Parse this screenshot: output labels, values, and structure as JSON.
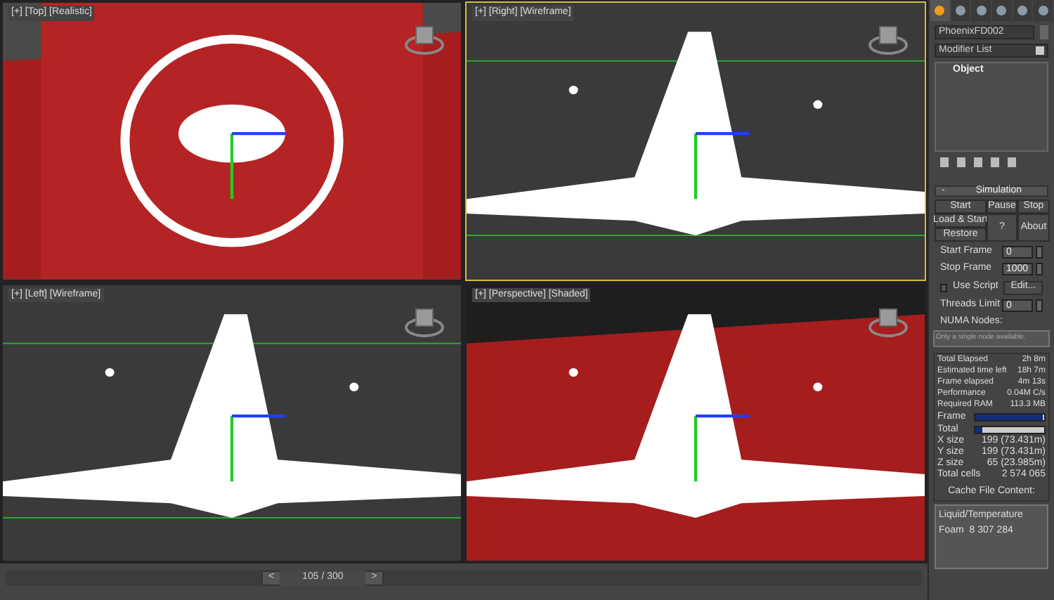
{
  "viewports": [
    {
      "label": "[+] [Top] [Realistic]",
      "kind": "realistic",
      "active": false
    },
    {
      "label": "[+] [Right] [Wireframe]",
      "kind": "wireframe",
      "active": true
    },
    {
      "label": "[+] [Left] [Wireframe]",
      "kind": "wireframe",
      "active": false
    },
    {
      "label": "[+] [Perspective] [Shaded]",
      "kind": "shaded",
      "active": false
    }
  ],
  "time_slider": {
    "prev": "<",
    "thumb": "105 / 300",
    "next": ">"
  },
  "command_panel": {
    "tabs": [
      {
        "selected": true
      },
      {
        "selected": false
      },
      {
        "selected": false
      },
      {
        "selected": false
      },
      {
        "selected": false
      },
      {
        "selected": false
      }
    ],
    "object_name": "PhoenixFD002",
    "modifier_list": "Modifier List",
    "stack": [
      "Object"
    ],
    "rollout": {
      "collapse": "-",
      "title": "Simulation"
    },
    "buttons": {
      "start": "Start",
      "pause": "Pause",
      "stop": "Stop",
      "load_start": "Load & Start",
      "help": "?",
      "about": "About",
      "restore": "Restore"
    },
    "start_frame": {
      "label": "Start Frame",
      "value": "0"
    },
    "stop_frame": {
      "label": "Stop Frame",
      "value": "1000"
    },
    "use_script": {
      "label": "Use Script",
      "checked": false,
      "edit": "Edit..."
    },
    "threads_limit": {
      "label": "Threads Limit",
      "value": "0"
    },
    "numa": {
      "label": "NUMA Nodes:",
      "placeholder": "Only a single node available."
    },
    "stats": [
      {
        "label": "Total Elapsed",
        "value": "2h 8m"
      },
      {
        "label": "Estimated time left",
        "value": "18h 7m"
      },
      {
        "label": "Frame elapsed",
        "value": "4m 13s"
      },
      {
        "label": "Performance",
        "value": "0.04M C/s"
      },
      {
        "label": "Required RAM",
        "value": "113.3 MB"
      }
    ],
    "progress": [
      {
        "label": "Frame",
        "level": 0.98
      },
      {
        "label": "Total",
        "level": 0.1
      }
    ],
    "sizes": [
      {
        "label": "X size",
        "value": "199 (73.431m)"
      },
      {
        "label": "Y size",
        "value": "199 (73.431m)"
      },
      {
        "label": "Z size",
        "value": "65 (23.985m)"
      },
      {
        "label": "Total cells",
        "value": "2 574 065"
      }
    ],
    "cache": {
      "label": "Cache File Content:",
      "lines": [
        "Liquid/Temperature",
        "Foam  8 307 284"
      ]
    }
  }
}
